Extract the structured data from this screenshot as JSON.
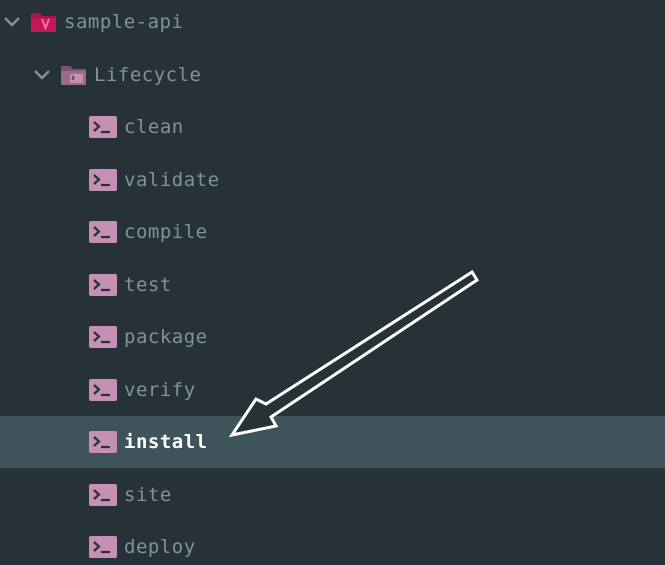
{
  "project": {
    "name": "sample-api",
    "expanded": true,
    "icon": "maven-project-icon"
  },
  "lifecycle": {
    "label": "Lifecycle",
    "expanded": true,
    "icon": "lifecycle-folder-icon"
  },
  "goals": [
    {
      "label": "clean",
      "icon": "terminal-icon"
    },
    {
      "label": "validate",
      "icon": "terminal-icon"
    },
    {
      "label": "compile",
      "icon": "terminal-icon"
    },
    {
      "label": "test",
      "icon": "terminal-icon"
    },
    {
      "label": "package",
      "icon": "terminal-icon"
    },
    {
      "label": "verify",
      "icon": "terminal-icon"
    },
    {
      "label": "install",
      "icon": "terminal-icon",
      "selected": true
    },
    {
      "label": "site",
      "icon": "terminal-icon"
    },
    {
      "label": "deploy",
      "icon": "terminal-icon"
    }
  ],
  "colors": {
    "background": "#263238",
    "selected_row": "#3f535a",
    "text": "#7f939b",
    "selected_text": "#ffffff",
    "terminal_icon": "#c58fb6",
    "project_icon": "#c2185b",
    "folder_icon": "#9c6b8c",
    "annotation_arrow": "#ffffff"
  }
}
